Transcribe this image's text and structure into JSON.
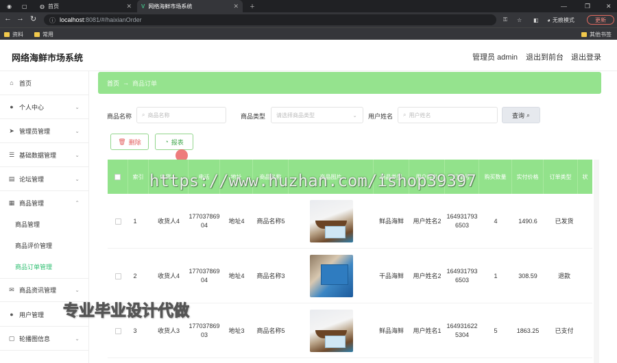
{
  "browser": {
    "tabs": [
      {
        "label": "首页"
      },
      {
        "label": "网络海鲜市场系统"
      }
    ],
    "url_host": "localhost",
    "url_path": ":8081/#/haixianOrder",
    "incognito_label": "无痕模式",
    "update_label": "更新",
    "bookmarks": [
      "资料",
      "常用"
    ],
    "other_bookmarks": "其他书签"
  },
  "header": {
    "title": "网络海鲜市场系统",
    "user": "管理员 admin",
    "frontend": "退出到前台",
    "logout": "退出登录"
  },
  "sidebar": {
    "items": [
      {
        "label": "首页",
        "icon": "home-icon"
      },
      {
        "label": "个人中心",
        "icon": "user-icon"
      },
      {
        "label": "管理员管理",
        "icon": "send-icon"
      },
      {
        "label": "基础数据管理",
        "icon": "sliders-icon"
      },
      {
        "label": "论坛管理",
        "icon": "doc-icon"
      },
      {
        "label": "商品管理",
        "icon": "grid-icon"
      },
      {
        "label": "商品资讯管理",
        "icon": "mail-icon"
      },
      {
        "label": "用户管理",
        "icon": "pin-icon"
      },
      {
        "label": "轮播图信息",
        "icon": "image-icon"
      }
    ],
    "sub_items": [
      {
        "label": "商品管理"
      },
      {
        "label": "商品评价管理"
      },
      {
        "label": "商品订单管理"
      }
    ]
  },
  "breadcrumb": {
    "home": "首页",
    "sep": "→",
    "current": "商品订单"
  },
  "filters": {
    "name_label": "商品名称",
    "name_placeholder": "商品名称",
    "type_label": "商品类型",
    "type_placeholder": "请选择商品类型",
    "user_label": "用户姓名",
    "user_placeholder": "用户姓名",
    "query_label": "查询"
  },
  "actions": {
    "delete": "删除",
    "report": "报表"
  },
  "table": {
    "headers": [
      "索引",
      "收货人",
      "电话",
      "地址",
      "商品名称",
      "商品图片",
      "商品类型",
      "用户姓名",
      "订单号",
      "购买数量",
      "实付价格",
      "订单类型",
      "状"
    ],
    "rows": [
      {
        "index": "1",
        "receiver": "收货人4",
        "phone": "17703786904",
        "address": "地址4",
        "goods": "商品名称5",
        "type": "鲜品海鲜",
        "user": "用户姓名2",
        "order": "1649317936503",
        "qty": "4",
        "price": "1490.6",
        "status": "已发货"
      },
      {
        "index": "2",
        "receiver": "收货人4",
        "phone": "17703786904",
        "address": "地址4",
        "goods": "商品名称3",
        "type": "干品海鲜",
        "user": "用户姓名2",
        "order": "1649317936503",
        "qty": "1",
        "price": "308.59",
        "status": "退款"
      },
      {
        "index": "3",
        "receiver": "收货人3",
        "phone": "17703786903",
        "address": "地址3",
        "goods": "商品名称5",
        "type": "鲜品海鲜",
        "user": "用户姓名1",
        "order": "1649316225304",
        "qty": "5",
        "price": "1863.25",
        "status": "已支付"
      }
    ]
  },
  "overlays": {
    "watermark": "https://www.huzhan.com/ishop39397",
    "promo": "专业毕业设计代做"
  }
}
